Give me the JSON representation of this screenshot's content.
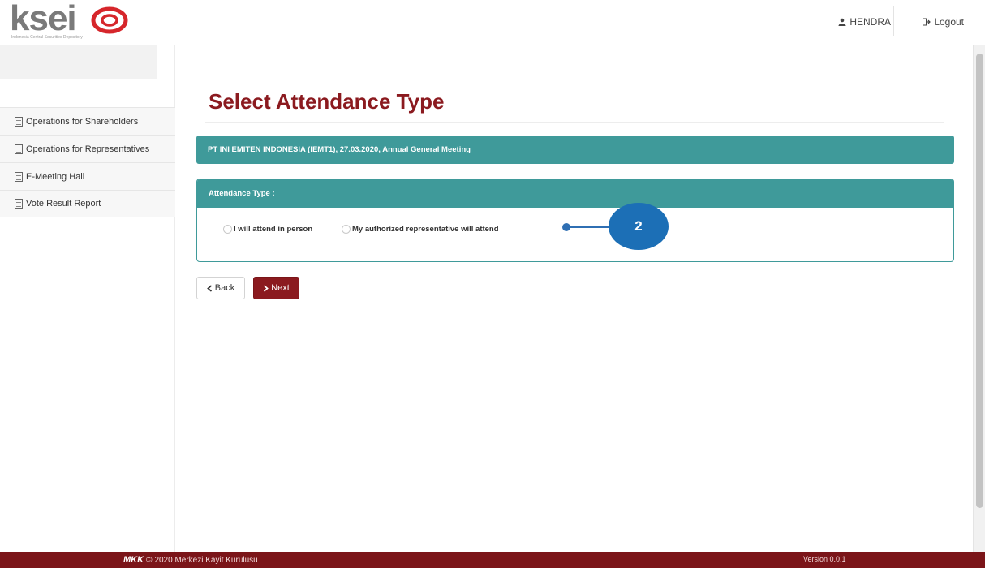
{
  "header": {
    "logo_text": "ksei",
    "logo_subtext": "Indonesia Central Securities Depository",
    "user_name": "HENDRA",
    "logout_label": "Logout"
  },
  "sidebar": {
    "items": [
      {
        "label": "Operations for Shareholders"
      },
      {
        "label": "Operations for Representatives"
      },
      {
        "label": "E-Meeting Hall"
      },
      {
        "label": "Vote Result Report"
      }
    ]
  },
  "main": {
    "title": "Select Attendance Type",
    "meeting_info": "PT INI EMITEN INDONESIA (IEMT1), 27.03.2020, Annual General Meeting",
    "panel_title": "Attendance Type :",
    "options": [
      {
        "label": "I will attend in person",
        "selected": false
      },
      {
        "label": "My authorized representative will attend",
        "selected": false
      }
    ],
    "back_label": "Back",
    "next_label": "Next"
  },
  "annotation": {
    "step": "2"
  },
  "footer": {
    "brand": "MKK",
    "copyright": "2020 Merkezi Kayit Kurulusu",
    "version": "Version 0.0.1"
  },
  "colors": {
    "brand_red": "#8b1a1f",
    "teal": "#3f9a9a",
    "footer_red": "#7b1519",
    "callout_blue": "#1c6fb6"
  }
}
